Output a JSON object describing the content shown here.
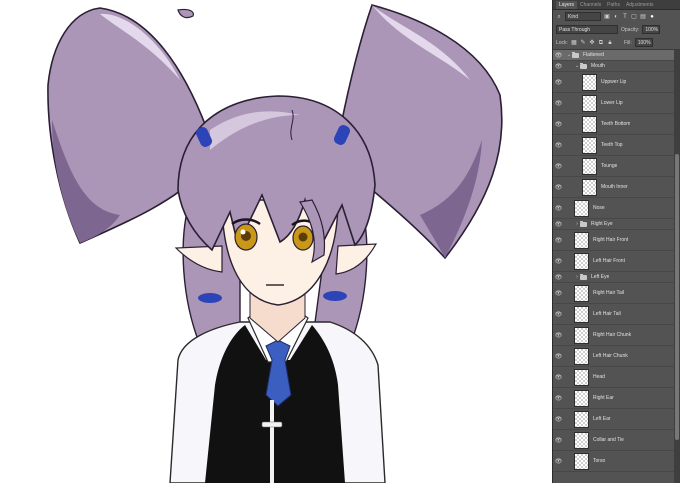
{
  "panel": {
    "tabs": [
      "Layers",
      "Channels",
      "Paths",
      "Adjustments"
    ],
    "active_tab": 0,
    "filter_kind": "Kind",
    "blend_mode": "Pass Through",
    "opacity_label": "Opacity:",
    "opacity_value": "100%",
    "lock_label": "Lock:",
    "fill_label": "Fill:",
    "fill_value": "100%"
  },
  "layers": [
    {
      "name": "Flattened",
      "type": "group",
      "expanded": true,
      "depth": 0,
      "selected": true
    },
    {
      "name": "Mouth",
      "type": "group",
      "expanded": true,
      "depth": 1
    },
    {
      "name": "Uppwer Lip",
      "type": "layer",
      "depth": 2
    },
    {
      "name": "Lower Lip",
      "type": "layer",
      "depth": 2
    },
    {
      "name": "Teeth Bottom",
      "type": "layer",
      "depth": 2
    },
    {
      "name": "Teeth Top",
      "type": "layer",
      "depth": 2
    },
    {
      "name": "Tounge",
      "type": "layer",
      "depth": 2
    },
    {
      "name": "Mouth Inner",
      "type": "layer",
      "depth": 2
    },
    {
      "name": "Nose",
      "type": "layer",
      "depth": 1
    },
    {
      "name": "Right Eye",
      "type": "group",
      "expanded": false,
      "depth": 1
    },
    {
      "name": "Right Hair Front",
      "type": "layer",
      "depth": 1
    },
    {
      "name": "Left Hair Front",
      "type": "layer",
      "depth": 1
    },
    {
      "name": "Left Eye",
      "type": "group",
      "expanded": false,
      "depth": 1
    },
    {
      "name": "Right Hair Tail",
      "type": "layer",
      "depth": 1
    },
    {
      "name": "Left Hair Tail",
      "type": "layer",
      "depth": 1
    },
    {
      "name": "Right Hair Chunk",
      "type": "layer",
      "depth": 1
    },
    {
      "name": "Left Hair Chunk",
      "type": "layer",
      "depth": 1
    },
    {
      "name": "Head",
      "type": "layer",
      "depth": 1
    },
    {
      "name": "Right Ear",
      "type": "layer",
      "depth": 1
    },
    {
      "name": "Left Ear",
      "type": "layer",
      "depth": 1
    },
    {
      "name": "Collar and Tie",
      "type": "layer",
      "depth": 1
    },
    {
      "name": "Torso",
      "type": "layer",
      "depth": 1
    }
  ],
  "colors": {
    "hair": "#ab96b8",
    "hair_shadow": "#7d6690",
    "skin": "#fdf1e6",
    "eye": "#c99818",
    "tie": "#3b5fc0",
    "hair_tie": "#2c44b8",
    "vest": "#111111",
    "panel_bg": "#535353"
  },
  "icons": {
    "visibility": "eye-icon",
    "group": "folder-icon",
    "filter": "search-icon"
  }
}
